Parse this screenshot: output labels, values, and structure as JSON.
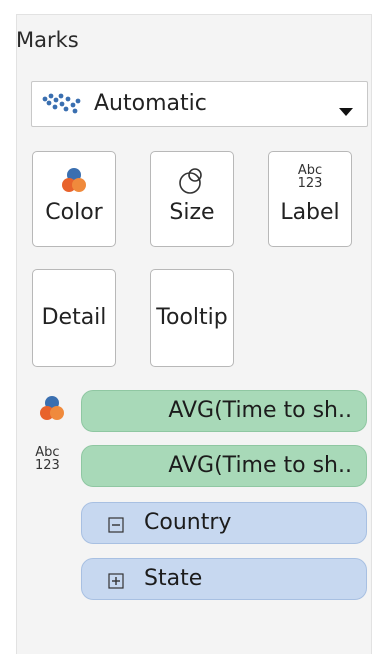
{
  "panel": {
    "title": "Marks"
  },
  "mark_type": {
    "value": "Automatic",
    "icon": "automatic-mark-icon"
  },
  "cards": {
    "color": "Color",
    "size": "Size",
    "label": "Label",
    "detail": "Detail",
    "tooltip": "Tooltip"
  },
  "label_icon": {
    "line1": "Abc",
    "line2": "123"
  },
  "shelf": [
    {
      "text": "AVG(Time to sh..",
      "kind": "measure",
      "encoding": "color"
    },
    {
      "text": "AVG(Time to sh..",
      "kind": "measure",
      "encoding": "label"
    },
    {
      "text": "Country",
      "kind": "dimension",
      "expand": "⊟"
    },
    {
      "text": "State",
      "kind": "dimension",
      "expand": "⊞"
    }
  ],
  "colors": {
    "measure_pill": "#a8d9b8",
    "dimension_pill": "#c7d8f0",
    "dot_orange": "#e8632c",
    "dot_blue": "#3a6fb0"
  }
}
